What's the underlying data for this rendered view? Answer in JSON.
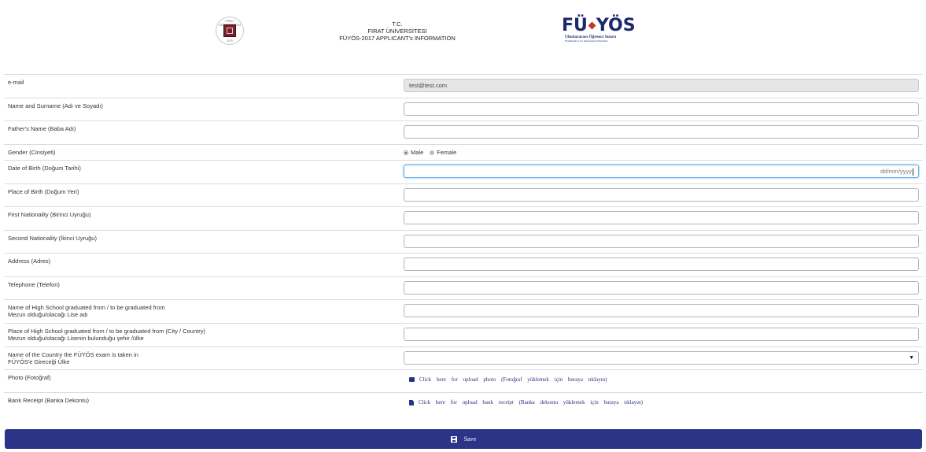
{
  "header": {
    "seal": {
      "icon": "university-seal-icon",
      "text_top": "FIRAT ÜNİVERSİTESİ",
      "text_bottom": "1975"
    },
    "line1": "T.C.",
    "line2": "FIRAT ÜNİVERSİTESİ",
    "line3": "FÜYÖS-2017 APPLICANT's INFORMATION",
    "logo": {
      "icon": "fuyos-logo-icon",
      "word": "FÜYÖS",
      "sub": "Uluslararası Öğrenci Sınavı",
      "sub2": "Examination for International Students"
    }
  },
  "form": {
    "email": {
      "label": "e-mail",
      "value": "test@test.com"
    },
    "name": {
      "label": "Name and Surname (Adı ve Soyadı)",
      "value": ""
    },
    "father": {
      "label": "Father's Name (Baba Adı)",
      "value": ""
    },
    "gender": {
      "label": "Gender (Cinsiyeti)",
      "options": [
        "Male",
        "Female"
      ],
      "selected": "Male"
    },
    "dob": {
      "label": "Date of Birth (Doğum Tarihi)",
      "placeholder": "dd/mm/yyyy"
    },
    "pob": {
      "label": "Place of Birth (Doğum Yeri)",
      "value": ""
    },
    "nat1": {
      "label": "First Nationality (Birinci Uyruğu)",
      "value": ""
    },
    "nat2": {
      "label": "Second Nationality (İkinci Uyruğu)",
      "value": ""
    },
    "address": {
      "label": "Address (Adres)",
      "value": ""
    },
    "phone": {
      "label": "Telephone (Telefon)",
      "value": ""
    },
    "hs_name": {
      "label_1": "Name of High School graduated from / to be graduated from",
      "label_2": "Mezun olduğu/olacağı Lise adı",
      "value": ""
    },
    "hs_place": {
      "label_1": "Place of High School graduated from / to be graduated from (City / Country)",
      "label_2": "Mezun olduğu/olacağı Lisenin bulunduğu şehir /ülke",
      "value": ""
    },
    "exam_country": {
      "label_1": "Name of the Country the FÜYÖS exam is taken in",
      "label_2": "FÜYÖS'e Gireceği Ülke",
      "selected": ""
    },
    "photo": {
      "label": "Photo (Fotoğraf)",
      "link": "Click here for upload photo (Fotoğraf yüklemek için buraya tıklayın)",
      "icon": "camera-icon"
    },
    "receipt": {
      "label": "Bank Receipt (Banka Dekontu)",
      "link": "Click here for upload bank receipt (Banka dekontu yüklemek için buraya tıklayın)",
      "icon": "file-icon"
    }
  },
  "save": {
    "label": "Save",
    "icon": "save-icon"
  },
  "colors": {
    "primary": "#2b3486",
    "link": "#2a3580",
    "border": "#dcdcdc",
    "readonly_bg": "#e6e6e6"
  }
}
